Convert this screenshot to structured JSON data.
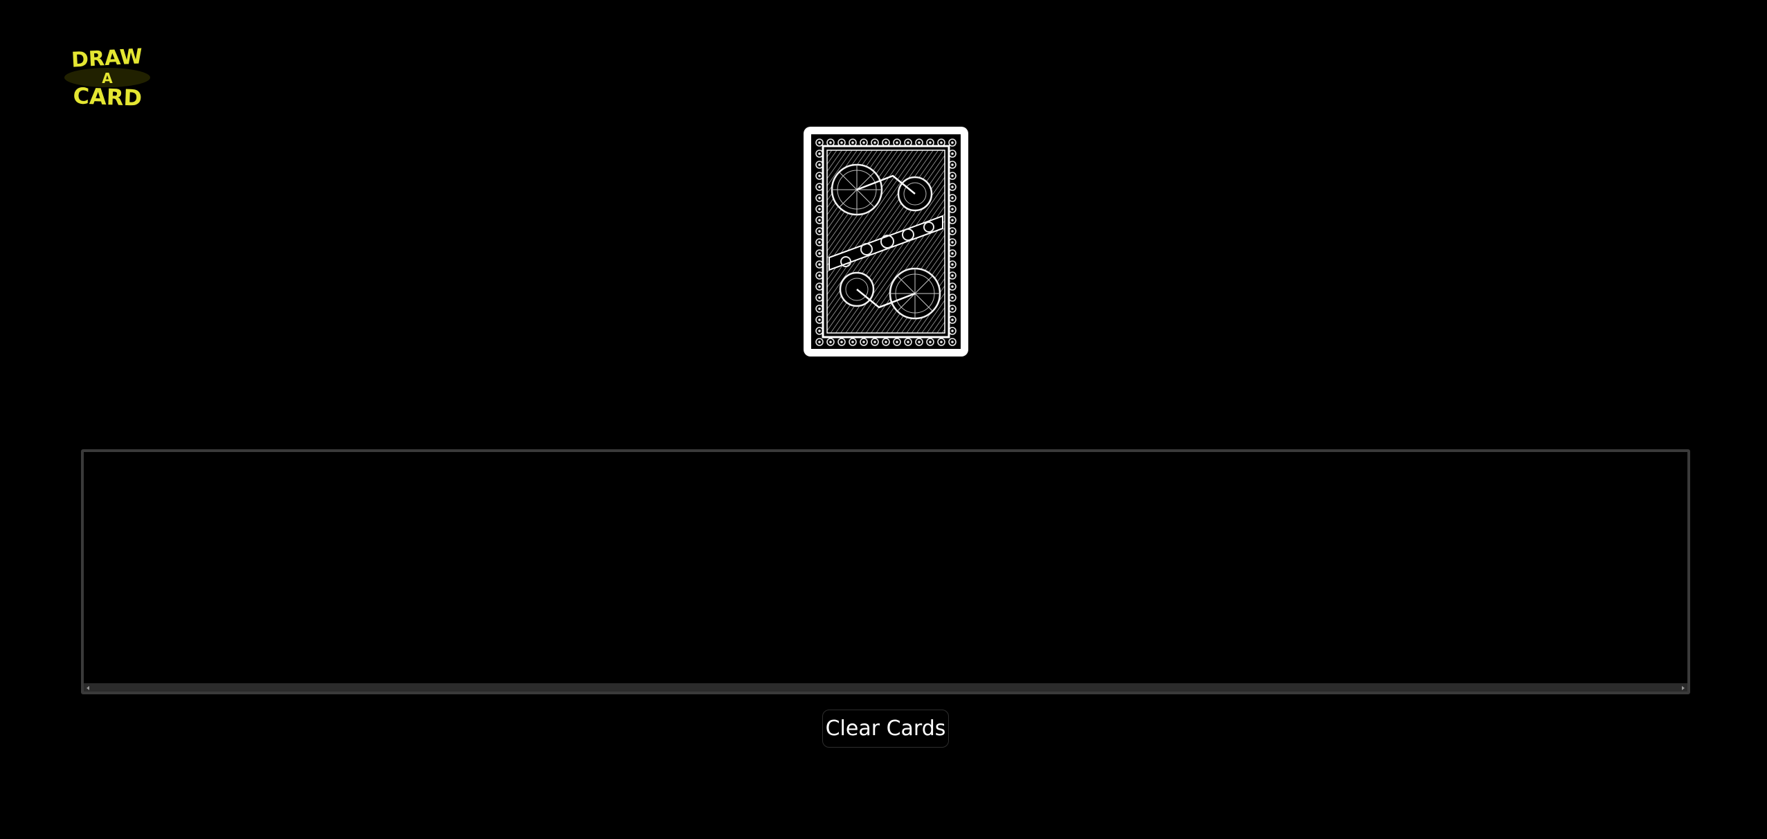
{
  "logo": {
    "line1": "DRAW",
    "line2": "A",
    "line3": "CARD",
    "color": "#e4e632"
  },
  "deck": {
    "icon": "card-back-icon"
  },
  "tray": {
    "scrollbar": {
      "left_arrow_icon": "scroll-left-arrow-icon",
      "right_arrow_icon": "scroll-right-arrow-icon"
    }
  },
  "clear_button": {
    "label": "Clear Cards"
  },
  "colors": {
    "background": "#000000",
    "tray_border": "#3a3a3a",
    "card_white": "#ffffff"
  }
}
